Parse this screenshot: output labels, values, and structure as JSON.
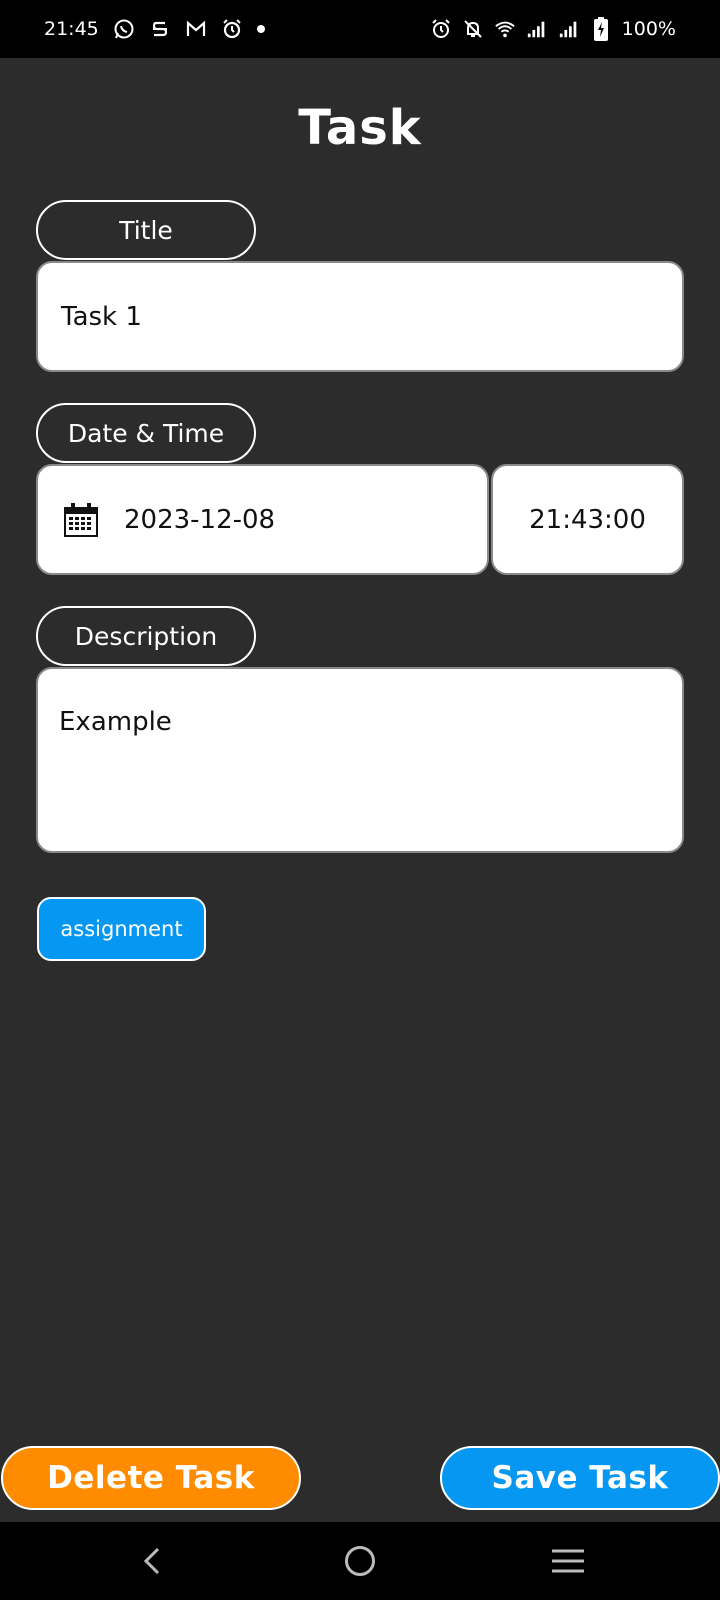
{
  "status_bar": {
    "time": "21:45",
    "left_icons": [
      "whatsapp-icon",
      "s-app-icon",
      "gmail-icon",
      "alarm-icon",
      "notification-dot"
    ],
    "right_icons": [
      "alarm-icon",
      "notifications-off-icon",
      "wifi-icon",
      "signal-icon",
      "signal-icon",
      "battery-charging-icon"
    ],
    "battery": "100%"
  },
  "page": {
    "title": "Task"
  },
  "form": {
    "title_label": "Title",
    "title_value": "Task 1",
    "datetime_label": "Date & Time",
    "date_value": "2023-12-08",
    "time_value": "21:43:00",
    "description_label": "Description",
    "description_value": "Example",
    "category_chip": "assignment"
  },
  "actions": {
    "delete_label": "Delete Task",
    "save_label": "Save Task"
  },
  "nav": {
    "icons": [
      "back-icon",
      "home-icon",
      "recents-icon"
    ]
  },
  "colors": {
    "background": "#2c2c2c",
    "accent_blue": "#0597f2",
    "accent_orange": "#ff8c00",
    "field_bg": "#ffffff"
  }
}
